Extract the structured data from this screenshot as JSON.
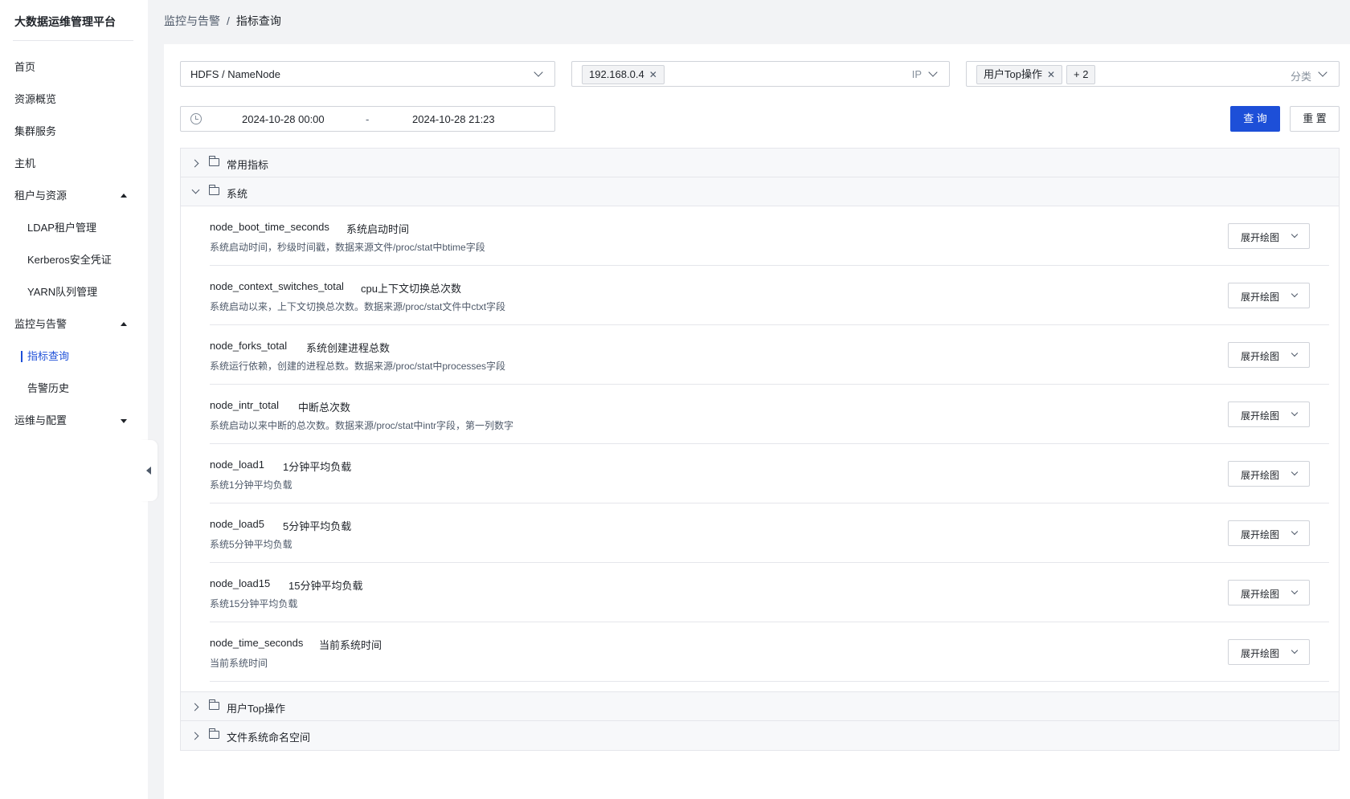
{
  "app": {
    "title": "大数据运维管理平台"
  },
  "sidebar": {
    "items": [
      {
        "label": "首页"
      },
      {
        "label": "资源概览"
      },
      {
        "label": "集群服务"
      },
      {
        "label": "主机"
      },
      {
        "label": "租户与资源",
        "expanded": true
      },
      {
        "label": "LDAP租户管理"
      },
      {
        "label": "Kerberos安全凭证"
      },
      {
        "label": "YARN队列管理"
      },
      {
        "label": "监控与告警",
        "expanded": true
      },
      {
        "label": "指标查询",
        "active": true
      },
      {
        "label": "告警历史"
      },
      {
        "label": "运维与配置",
        "expanded": false
      }
    ]
  },
  "breadcrumb": {
    "parent": "监控与告警",
    "separator": "/",
    "current": "指标查询"
  },
  "filters": {
    "component": "HDFS / NameNode",
    "ip": {
      "tag": "192.168.0.4",
      "suffix": "IP"
    },
    "category": {
      "tag": "用户Top操作",
      "more": "+ 2",
      "suffix": "分类"
    },
    "date_start": "2024-10-28 00:00",
    "date_sep": "-",
    "date_end": "2024-10-28 21:23"
  },
  "buttons": {
    "query": "查 询",
    "reset": "重 置"
  },
  "groups": [
    {
      "label": "常用指标",
      "expanded": false
    },
    {
      "label": "系统",
      "expanded": true
    },
    {
      "label": "用户Top操作",
      "expanded": false
    },
    {
      "label": "文件系统命名空间",
      "expanded": false
    }
  ],
  "metrics": [
    {
      "name": "node_boot_time_seconds",
      "title": "系统启动时间",
      "desc": "系统启动时间，秒级时间戳，数据来源文件/proc/stat中btime字段"
    },
    {
      "name": "node_context_switches_total",
      "title": "cpu上下文切换总次数",
      "desc": "系统启动以来，上下文切换总次数。数据来源/proc/stat文件中ctxt字段"
    },
    {
      "name": "node_forks_total",
      "title": "系统创建进程总数",
      "desc": "系统运行依赖，创建的进程总数。数据来源/proc/stat中processes字段"
    },
    {
      "name": "node_intr_total",
      "title": "中断总次数",
      "desc": "系统启动以来中断的总次数。数据来源/proc/stat中intr字段，第一列数字"
    },
    {
      "name": "node_load1",
      "title": "1分钟平均负载",
      "desc": "系统1分钟平均负载"
    },
    {
      "name": "node_load5",
      "title": "5分钟平均负载",
      "desc": "系统5分钟平均负载"
    },
    {
      "name": "node_load15",
      "title": "15分钟平均负载",
      "desc": "系统15分钟平均负载"
    },
    {
      "name": "node_time_seconds",
      "title": "当前系统时间",
      "desc": "当前系统时间"
    }
  ],
  "metric_button_label": "展开绘图",
  "colors": {
    "primary": "#1d4fd8",
    "border": "#d0d3d9",
    "text": "#1f2329",
    "muted": "#4e5969",
    "background": "#f2f3f5"
  }
}
